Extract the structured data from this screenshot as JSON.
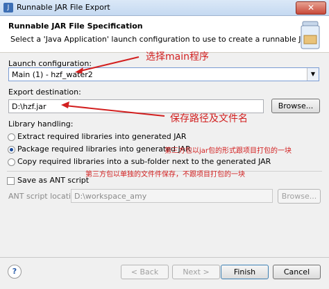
{
  "window": {
    "title": "Runnable JAR File Export",
    "close_glyph": "✕"
  },
  "header": {
    "title": "Runnable JAR File Specification",
    "description": "Select a 'Java Application' launch configuration to use to create a runnable JAR."
  },
  "launch": {
    "label": "Launch configuration:",
    "selected": "Main (1) - hzf_water2"
  },
  "export": {
    "label": "Export destination:",
    "value": "D:\\hzf.jar",
    "browse_label": "Browse..."
  },
  "library": {
    "label": "Library handling:",
    "options": [
      {
        "label": "Extract required libraries into generated JAR",
        "checked": false
      },
      {
        "label": "Package required libraries into generated JAR",
        "checked": true
      },
      {
        "label": "Copy required libraries into a sub-folder next to the generated JAR",
        "checked": false
      }
    ]
  },
  "ant": {
    "checkbox_label": "Save as ANT script",
    "location_label": "ANT script location:",
    "location_value": "D:\\workspace_amy",
    "browse_label": "Browse..."
  },
  "annotations": {
    "select_main": "选择main程序",
    "save_path": "保存路径及文件名",
    "package_note": "第三方包以jar包的形式跟项目打包的一块",
    "copy_note": "第三方包以单独的文件件保存，不跟项目打包的一块"
  },
  "footer": {
    "help_glyph": "?",
    "back_label": "< Back",
    "next_label": "Next >",
    "finish_label": "Finish",
    "cancel_label": "Cancel"
  },
  "colors": {
    "annotation": "#d21f1f",
    "accent": "#3d6fb4"
  }
}
